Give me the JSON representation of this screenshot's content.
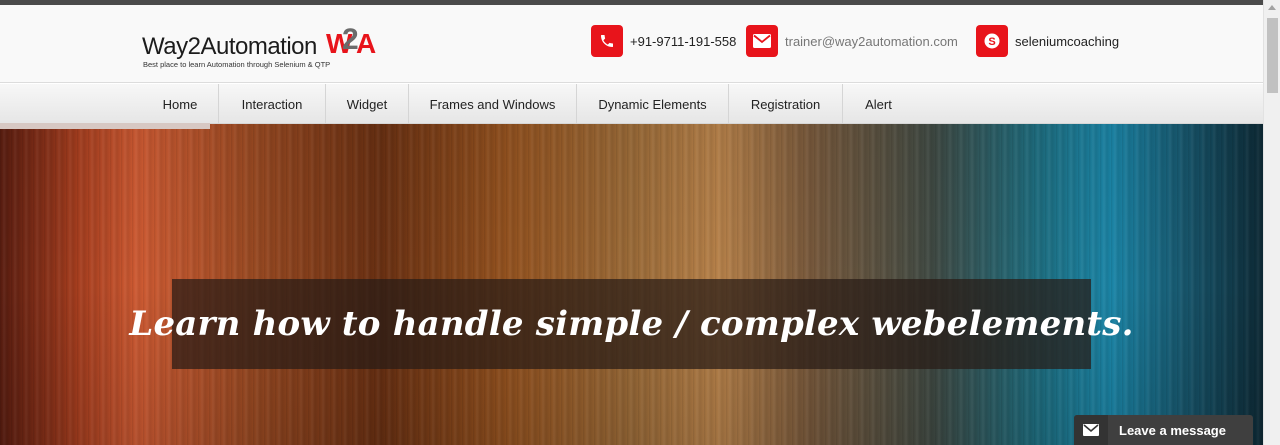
{
  "header": {
    "logo": {
      "name": "Way2Automation",
      "mark": "W2A",
      "tagline": "Best place to learn Automation through Selenium & QTP"
    },
    "contacts": [
      {
        "icon": "phone-icon",
        "text": "+91-9711-191-558"
      },
      {
        "icon": "mail-icon",
        "text": "trainer@way2automation.com"
      },
      {
        "icon": "skype-icon",
        "text": "seleniumcoaching"
      }
    ]
  },
  "nav": {
    "items": [
      {
        "label": "Home"
      },
      {
        "label": "Interaction"
      },
      {
        "label": "Widget"
      },
      {
        "label": "Frames and Windows"
      },
      {
        "label": "Dynamic Elements"
      },
      {
        "label": "Registration"
      },
      {
        "label": "Alert"
      }
    ]
  },
  "hero": {
    "caption": "Learn how to handle simple / complex webelements."
  },
  "chat": {
    "icon": "mail-icon",
    "label": "Leave a message"
  },
  "colors": {
    "accent": "#e8141b",
    "topStrip": "#4b4b4b",
    "chatBg": "#3f3f3f"
  }
}
